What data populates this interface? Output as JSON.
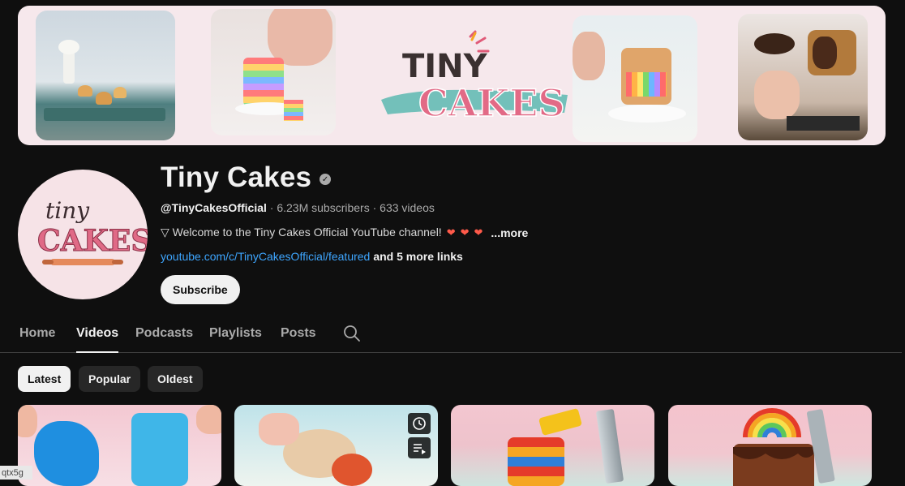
{
  "banner": {
    "wordmark_line1": "TINY",
    "wordmark_line2": "CAKES"
  },
  "avatar": {
    "line1": "tiny",
    "line2": "CAKES"
  },
  "channel": {
    "name": "Tiny Cakes",
    "handle": "@TinyCakesOfficial",
    "stats": " · 6.23M subscribers · 633 videos",
    "description": "▽ Welcome to the Tiny Cakes Official YouTube channel!",
    "description_more": "...more",
    "link_url": "youtube.com/c/TinyCakesOfficial/featured",
    "link_extra": "and 5 more links",
    "subscribe_label": "Subscribe"
  },
  "tabs": [
    {
      "label": "Home"
    },
    {
      "label": "Videos"
    },
    {
      "label": "Podcasts"
    },
    {
      "label": "Playlists"
    },
    {
      "label": "Posts"
    }
  ],
  "filters": [
    {
      "label": "Latest"
    },
    {
      "label": "Popular"
    },
    {
      "label": "Oldest"
    }
  ],
  "colors": {
    "background": "#0f0f0f",
    "link": "#3ea6ff",
    "banner": "#f6e8ec",
    "brand_pink": "#e05a78"
  },
  "watermark": "qtx5g"
}
